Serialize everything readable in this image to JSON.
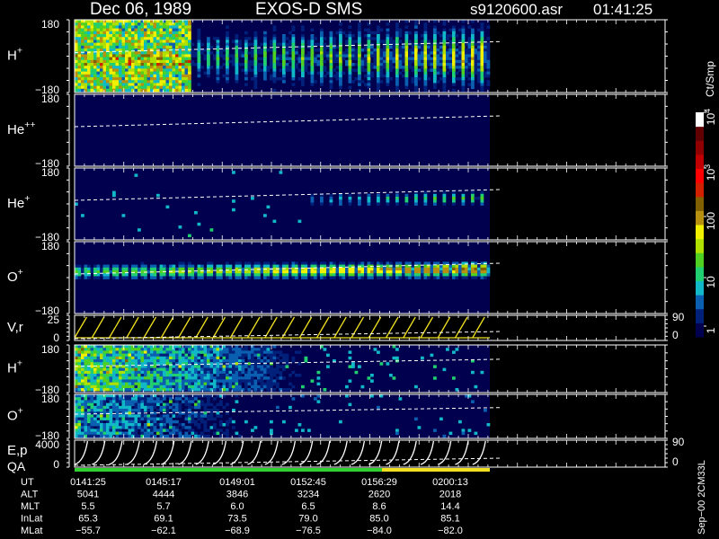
{
  "header": {
    "date": "Dec 06, 1989",
    "instrument": "EXOS-D SMS",
    "file": "s9120600.asr",
    "time": "01:41:25"
  },
  "panels": [
    {
      "id": "p1",
      "label": "H",
      "sup": "+",
      "ytop": "180",
      "ybot": "−180",
      "kind": "spectro",
      "species": "h1"
    },
    {
      "id": "p2",
      "label": "He",
      "sup": "++",
      "ytop": "180",
      "ybot": "−180",
      "kind": "spectro",
      "species": "he2"
    },
    {
      "id": "p3",
      "label": "He",
      "sup": "+",
      "ytop": "180",
      "ybot": "−180",
      "kind": "spectro",
      "species": "he1"
    },
    {
      "id": "p4",
      "label": "O",
      "sup": "+",
      "ytop": "180",
      "ybot": "−180",
      "kind": "spectro",
      "species": "o1"
    },
    {
      "id": "p5",
      "label": "V,r",
      "sup": "",
      "ytop": "25",
      "ybot": "0",
      "right_top": "90",
      "right_bot": "0",
      "kind": "line"
    },
    {
      "id": "p6",
      "label": "H",
      "sup": "+",
      "ytop": "180",
      "ybot": "−180",
      "kind": "spectro",
      "species": "h1b"
    },
    {
      "id": "p7",
      "label": "O",
      "sup": "+",
      "ytop": "180",
      "ybot": "−180",
      "kind": "spectro",
      "species": "o1b"
    },
    {
      "id": "p8",
      "label": "E,p",
      "label2": "QA",
      "sup": "",
      "ytop": "4000",
      "ybot": "0",
      "right_top": "90",
      "right_bot": "0",
      "kind": "line"
    }
  ],
  "colorbar": {
    "unit": "Ct/Smp",
    "ticks": [
      {
        "label": "10",
        "sup": "4"
      },
      {
        "label": "10",
        "sup": "3"
      },
      {
        "label": "100",
        "sup": ""
      },
      {
        "label": "10",
        "sup": ""
      },
      {
        "label": "1",
        "sup": ""
      }
    ],
    "colors": [
      "#00004e",
      "#00207a",
      "#0a5fb0",
      "#10b8c8",
      "#20d070",
      "#50d020",
      "#b0e000",
      "#f0f000",
      "#b89010",
      "#806000",
      "#d02000",
      "#ff0000",
      "#c00000",
      "#900000",
      "#600000",
      "#ffffff"
    ]
  },
  "footer": {
    "rows": [
      {
        "name": "UT",
        "values": [
          "0141:25",
          "0145:17",
          "0149:01",
          "0152:45",
          "0156:29",
          "0200:13"
        ]
      },
      {
        "name": "ALT",
        "values": [
          "5041",
          "4444",
          "3846",
          "3234",
          "2620",
          "2018"
        ]
      },
      {
        "name": "MLT",
        "values": [
          "5.5",
          "5.7",
          "6.0",
          "6.5",
          "8.6",
          "14.4"
        ]
      },
      {
        "name": "InLat",
        "values": [
          "65.3",
          "69.1",
          "73.5",
          "79.0",
          "85.0",
          "85.1"
        ]
      },
      {
        "name": "MLat",
        "values": [
          "−55.7",
          "−62.1",
          "−68.9",
          "−76.5",
          "−84.0",
          "−82.0"
        ]
      }
    ]
  },
  "side_label": "Sep−00 2CM33L",
  "qa_bar": {
    "colors": [
      "#30d030",
      "#f0e020"
    ],
    "split_fraction": 0.74
  },
  "chart_data": {
    "type": "heatmap",
    "title": "Dec 06, 1989   EXOS-D SMS",
    "panels": [
      "H+",
      "He++",
      "He+",
      "O+",
      "V,r",
      "H+",
      "O+",
      "E,p / QA"
    ],
    "time_ticks": [
      "0141:25",
      "0145:17",
      "0149:01",
      "0152:45",
      "0156:29",
      "0200:13"
    ],
    "pitch_range": [
      -180,
      180
    ],
    "colorbar_range": [
      1,
      10000
    ],
    "colorbar_scale": "log",
    "colorbar_unit": "Ct/Smp"
  }
}
